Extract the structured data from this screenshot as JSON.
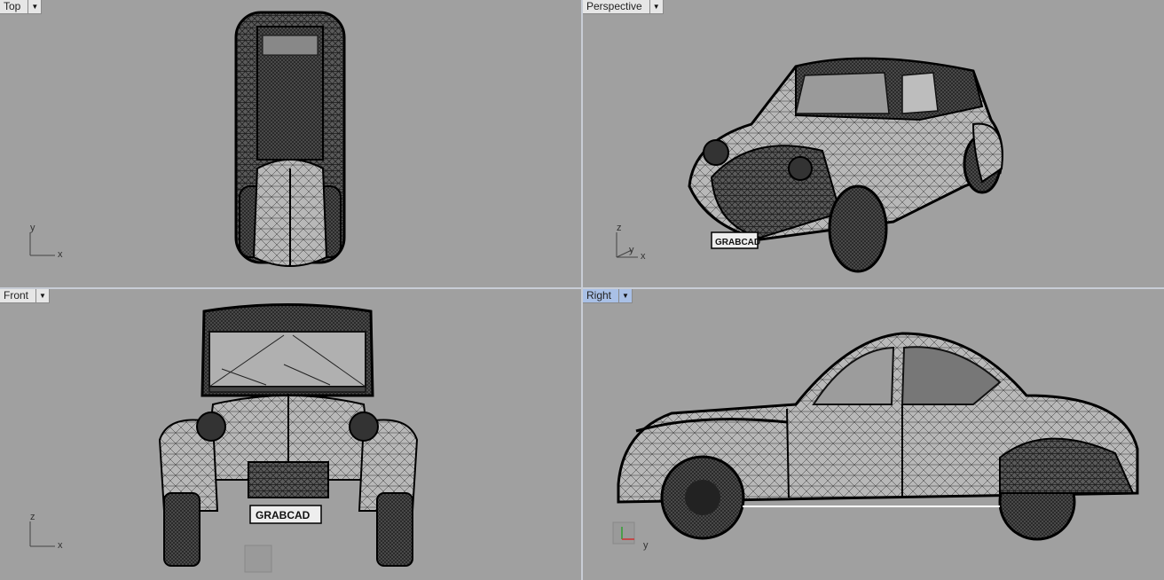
{
  "viewports": {
    "top": {
      "label": "Top",
      "axes": [
        "y",
        "x"
      ]
    },
    "perspective": {
      "label": "Perspective",
      "axes": [
        "z",
        "y",
        "x"
      ]
    },
    "front": {
      "label": "Front",
      "axes": [
        "z",
        "x"
      ]
    },
    "right": {
      "label": "Right",
      "axes": [
        "y"
      ]
    }
  },
  "plate_text": "GRABCAD",
  "icons": {
    "dropdown": "chevron-down-icon"
  },
  "colors": {
    "viewport_bg": "#a0a0a0",
    "active_tab": "#a9c0e6",
    "wire": "#111111",
    "axis_x": "#d03030",
    "axis_y": "#30a030"
  }
}
